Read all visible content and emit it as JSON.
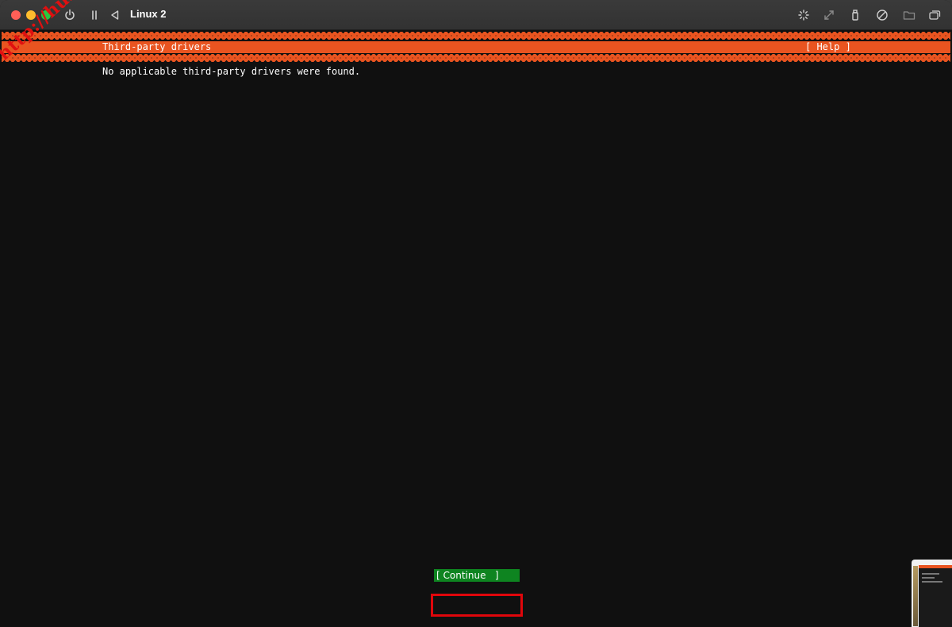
{
  "window": {
    "title": "Linux 2"
  },
  "toolbar": {
    "icons": [
      "power-icon",
      "pause-icon",
      "back-icon",
      "brightness-icon",
      "resize-icon",
      "usb-icon",
      "audio-icon",
      "folder-icon",
      "display-icon"
    ]
  },
  "installer": {
    "header_title": "Third-party drivers",
    "help_label": "[ Help ]",
    "message": "No applicable third-party drivers were found.",
    "continue_label": "[ Continue   ]"
  },
  "watermark": {
    "text": "http://hulkkr"
  },
  "colors": {
    "accent": "#e95420",
    "button": "#0e8420",
    "highlight_frame": "#e0060b",
    "background": "#101010"
  }
}
